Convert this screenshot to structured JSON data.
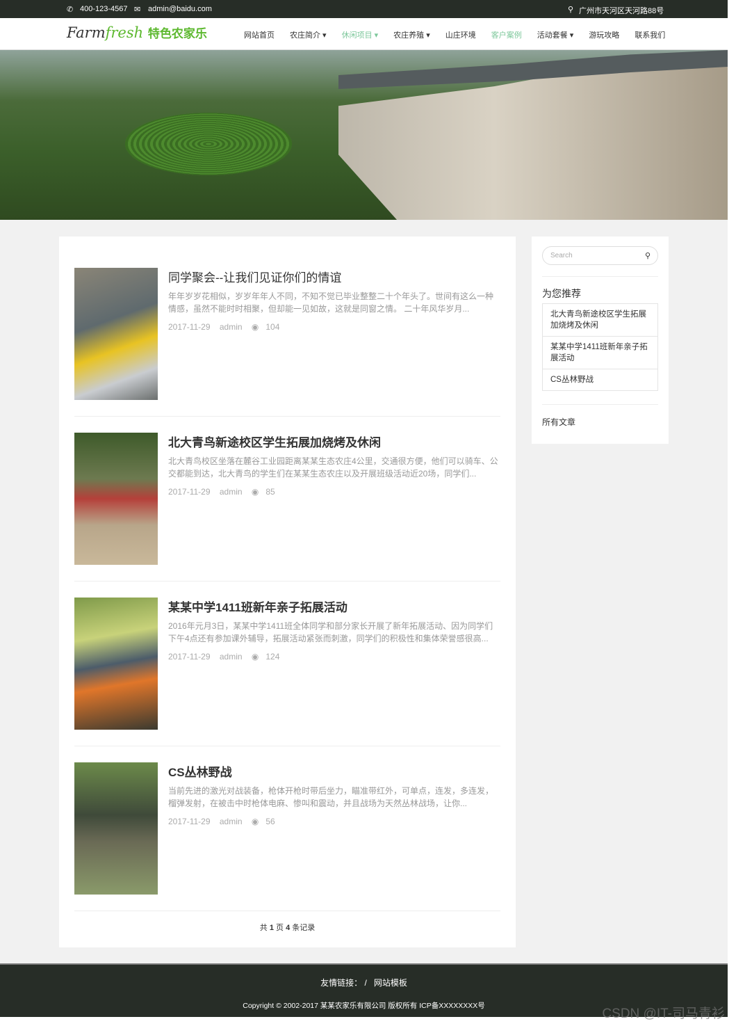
{
  "topbar": {
    "phone": "400-123-4567",
    "email": "admin@baidu.com",
    "address": "广州市天河区天河路88号"
  },
  "logo": {
    "en_a": "Farm",
    "en_b": "fresh",
    "cn": "特色农家乐"
  },
  "menu": [
    {
      "label": "网站首页"
    },
    {
      "label": "农庄简介 ▾"
    },
    {
      "label": "休闲项目 ▾",
      "active": true
    },
    {
      "label": "农庄养殖 ▾"
    },
    {
      "label": "山庄环境"
    },
    {
      "label": "客户案例",
      "active": true
    },
    {
      "label": "活动套餐 ▾"
    },
    {
      "label": "游玩攻略"
    },
    {
      "label": "联系我们"
    }
  ],
  "articles": [
    {
      "title": "同学聚会--让我们见证你们的情谊",
      "summary": "年年岁岁花相似，岁岁年年人不同，不知不觉已毕业整整二十个年头了。世间有这么一种情感，虽然不能时时相聚，但却能一见如故，这就是同窗之情。 二十年风华岁月...",
      "date": "2017-11-29",
      "author": "admin",
      "views": "104",
      "img": "rafting"
    },
    {
      "title": "北大青鸟新途校区学生拓展加烧烤及休闲",
      "summary": "北大青鸟校区坐落在麓谷工业园距离某某生态农庄4公里，交通很方便，他们可以骑车、公交都能到达，北大青鸟的学生们在某某生态农庄以及开展班级活动近20场，同学们...",
      "date": "2017-11-29",
      "author": "admin",
      "views": "85",
      "img": "drum-team"
    },
    {
      "title": "某某中学1411班新年亲子拓展活动",
      "summary": "2016年元月3日，某某中学1411班全体同学和部分家长开展了新年拓展活动、因为同学们下午4点还有参加课外辅导，拓展活动紧张而刺激，同学们的积极性和集体荣誉感很高...",
      "date": "2017-11-29",
      "author": "admin",
      "views": "124",
      "img": "parent-child"
    },
    {
      "title": "CS丛林野战",
      "summary": "当前先进的激光对战装备，枪体开枪时带后坐力，瞄准带红外，可单点，连发，多连发，榴弹发射，在被击中时枪体电麻、惨叫和震动，并且战场为天然丛林战场，让你...",
      "date": "2017-11-29",
      "author": "admin",
      "views": "56",
      "img": "cs-jungle"
    }
  ],
  "pager": {
    "a": "共 ",
    "pages": "1",
    "b": " 页 ",
    "count": "4",
    "c": " 条记录"
  },
  "sidebar": {
    "search_placeholder": "Search",
    "recommend_title": "为您推荐",
    "recommend": [
      "北大青鸟新途校区学生拓展加烧烤及休闲",
      "某某中学1411班新年亲子拓展活动",
      "CS丛林野战"
    ],
    "all_articles": "所有文章"
  },
  "footer": {
    "links_label": "友情链接：",
    "sep": "/",
    "link": "网站模板",
    "copyright": "Copyright © 2002-2017 某某农家乐有限公司 版权所有 ICP备XXXXXXXX号"
  },
  "watermark": "CSDN @IT-司马青衫",
  "colors": {
    "dark": "#272d27",
    "accent": "#5cb82e",
    "active_nav": "#7cc79a"
  }
}
